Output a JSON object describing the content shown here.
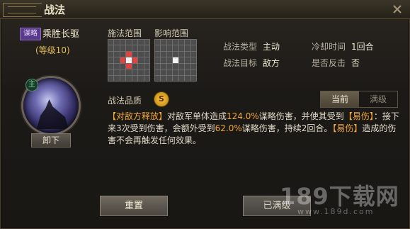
{
  "window": {
    "title": "战法"
  },
  "skill": {
    "tag": "谋略",
    "name": "乘胜长驱",
    "level": "(等级10)",
    "main_mark": "主",
    "unequip_label": "卸下"
  },
  "ranges": {
    "cast_label": "施法范围",
    "effect_label": "影响范围",
    "cast_grid": [
      [
        0,
        0,
        0,
        0,
        0,
        0,
        0
      ],
      [
        0,
        0,
        0,
        0,
        0,
        0,
        0
      ],
      [
        0,
        0,
        0,
        1,
        0,
        0,
        0
      ],
      [
        0,
        0,
        1,
        2,
        1,
        0,
        0
      ],
      [
        0,
        0,
        0,
        1,
        0,
        0,
        0
      ],
      [
        0,
        0,
        0,
        0,
        0,
        0,
        0
      ],
      [
        0,
        0,
        0,
        0,
        0,
        0,
        0
      ]
    ],
    "effect_grid": [
      [
        0,
        0,
        0,
        0,
        0,
        0,
        0
      ],
      [
        0,
        0,
        0,
        0,
        0,
        0,
        0
      ],
      [
        0,
        0,
        0,
        0,
        0,
        0,
        0
      ],
      [
        0,
        0,
        0,
        2,
        0,
        0,
        0
      ],
      [
        0,
        0,
        0,
        0,
        0,
        0,
        0
      ],
      [
        0,
        0,
        0,
        0,
        0,
        0,
        0
      ],
      [
        0,
        0,
        0,
        0,
        0,
        0,
        0
      ]
    ]
  },
  "stats": {
    "type_key": "战法类型",
    "type_val": "主动",
    "target_key": "战法目标",
    "target_val": "敌方",
    "cooldown_key": "冷却时间",
    "cooldown_val": "1回合",
    "counter_key": "是否反击",
    "counter_val": "否"
  },
  "quality": {
    "label": "战法品质",
    "grade": "S"
  },
  "tabs": {
    "current": "当前",
    "max": "满级"
  },
  "description": {
    "p1": "【对敌方释放】",
    "p2": "对敌军单体造成",
    "p3": "124.0%",
    "p4": "谋略伤害，并使其受到",
    "p5": "【易伤】",
    "p6": "：接下来3次受到伤害，会额外受到",
    "p7": "62.0%",
    "p8": "谋略伤害，持续2回合。",
    "p9": "【易伤】",
    "p10": "造成的伤害不会再触发任何效果。"
  },
  "buttons": {
    "reset": "重置",
    "maxed": "已满级"
  },
  "watermark": {
    "main": "189下载网",
    "sub": "www.189d.com"
  },
  "colors": {
    "highlight": "#f2a63a",
    "range_red": "#e0443e",
    "grade_gold": "#ffcc3d"
  }
}
